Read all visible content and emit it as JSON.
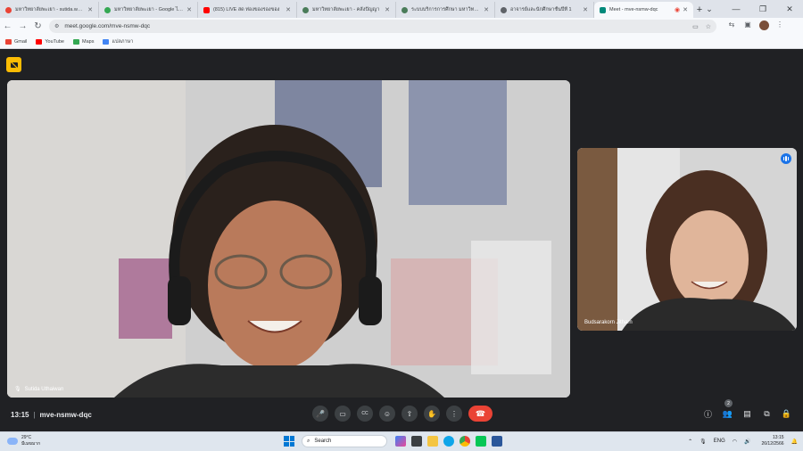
{
  "browser": {
    "tabs": [
      {
        "title": "มหาวิทยาลัยพะเยา - sutida.w@up.ac.th",
        "favicon_color": "#ea4335"
      },
      {
        "title": "มหาวิทยาลัยพะเยา - Google ไดรฟ์",
        "favicon_color": "#34a853"
      },
      {
        "title": "(815) LIVE สด ท่องของรองของ",
        "favicon_color": "#ff0000"
      },
      {
        "title": "มหาวิทยาลัยพะเยา - คลังปัญญา",
        "favicon_color": "#4a7c59"
      },
      {
        "title": "ระบบบริการการศึกษา มหาวิทยาลัย",
        "favicon_color": "#4a7c59"
      },
      {
        "title": "อาจารย์และนักศึกษาชั้นปีที่ 1",
        "favicon_color": "#5f6368"
      },
      {
        "title": "Meet - mve-nsmw-dqc",
        "favicon_color": "#00897b",
        "active": true
      }
    ],
    "new_tab": "+",
    "url": "meet.google.com/mve-nsmw-dqc",
    "bookmarks": [
      {
        "label": "Gmail",
        "color": "#ea4335"
      },
      {
        "label": "YouTube",
        "color": "#ff0000"
      },
      {
        "label": "Maps",
        "color": "#34a853"
      },
      {
        "label": "แปลภาษา",
        "color": "#4285f4"
      }
    ]
  },
  "meet": {
    "participants": [
      {
        "name": "Sutida Uthaiwan",
        "muted": true
      },
      {
        "name": "Budsarakorn Jitharn",
        "speaking": true
      }
    ],
    "time": "13:15",
    "meeting_code": "mve-nsmw-dqc",
    "people_count": "2",
    "accent": "#ea4335"
  },
  "taskbar": {
    "temperature": "29°C",
    "weather_desc": "มีเมฆมาก",
    "search_placeholder": "Search",
    "language": "ENG",
    "clock_time": "13:15",
    "clock_date": "26/12/2566"
  }
}
